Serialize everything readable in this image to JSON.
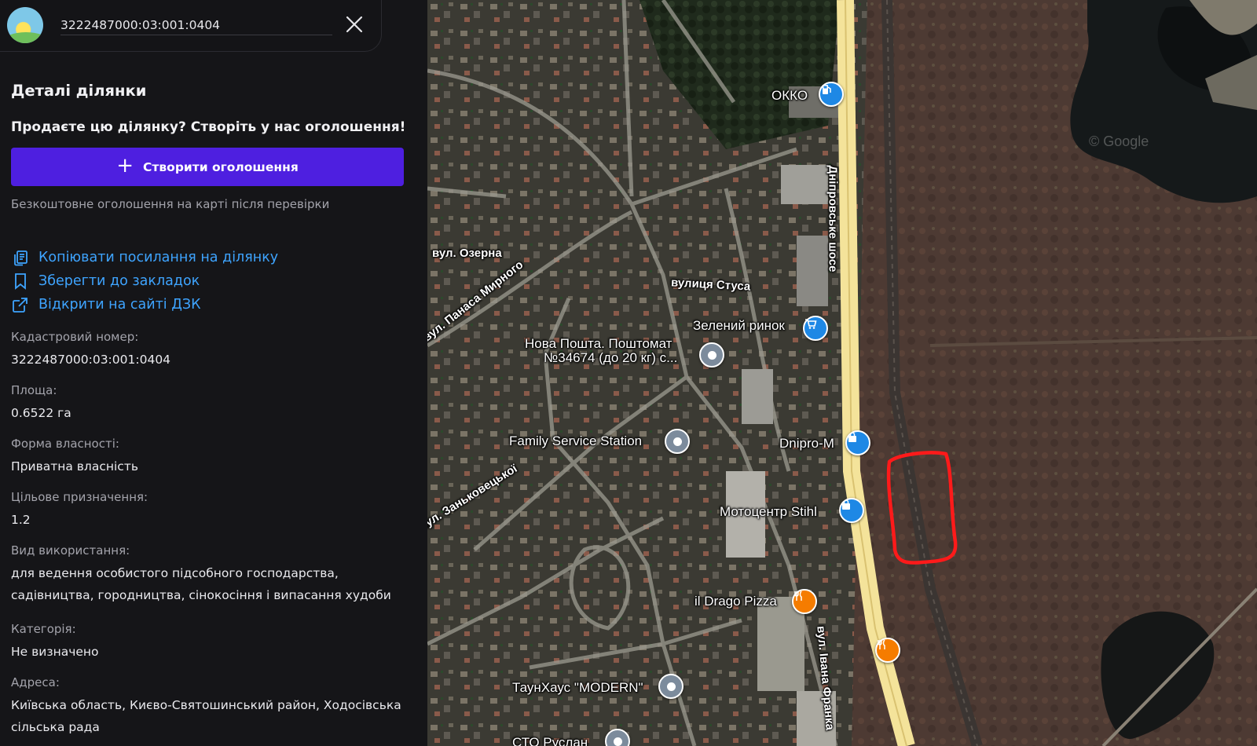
{
  "search": {
    "value": "3222487000:03:001:0404"
  },
  "panel": {
    "title": "Деталі ділянки",
    "promo": "Продаєте цю ділянку? Створіть у нас оголошення!",
    "create_button": "Створити оголошення",
    "note": "Безкоштовне оголошення на карті після перевірки",
    "actions": {
      "copy": "Копіювати посилання на ділянку",
      "bookmark": "Зберегти до закладок",
      "open": "Відкрити на сайті ДЗК"
    },
    "fields": {
      "cadastral": {
        "label": "Кадастровий номер:",
        "value": "3222487000:03:001:0404"
      },
      "area": {
        "label": "Площа:",
        "value": "0.6522 га"
      },
      "ownership": {
        "label": "Форма власності:",
        "value": "Приватна власність"
      },
      "purpose": {
        "label": "Цільове призначення:",
        "value": "1.2"
      },
      "usage": {
        "label": "Вид використання:",
        "value_line1": "для ведення особистого підсобного господарства,",
        "value_line2": "садівництва, городництва, сінокосіння і випасання худоби"
      },
      "category": {
        "label": "Категорія:",
        "value": "Не визначено"
      },
      "address": {
        "label": "Адреса:",
        "value_line1": "Київська область, Києво-Святошинський район, Ходосівська",
        "value_line2": "сільська рада"
      }
    }
  },
  "map": {
    "labels": {
      "okko": "ОККО",
      "dnipro_highway": "Дніпровське шосе",
      "ozerna": "вул. Озерна",
      "stusa": "вулиця Стуса",
      "panasa": "вул. Панаса Мирного",
      "zeleny": "Зелений ринок",
      "nova_poshta_1": "Нова Пошта. Поштомат",
      "nova_poshta_2": "№34674 (до 20 кг) с...",
      "family": "Family Service Station",
      "dnipro_m": "Dnipro-M",
      "zankovetskoi": "вул. Заньковецької",
      "stihl": "Мотоцентр Stihl",
      "drago": "il Drago Pizza",
      "ivana_franka": "вул. Івана Франка",
      "townhouse": "ТаунХаус \"MODERN\"",
      "sto": "СТО Руслан",
      "watermark": "© Google"
    },
    "colors": {
      "highlight": "#ff1a1a",
      "road": "#e9d98e",
      "panel_accent": "#4e1fe0",
      "link": "#3ea4ff"
    }
  }
}
